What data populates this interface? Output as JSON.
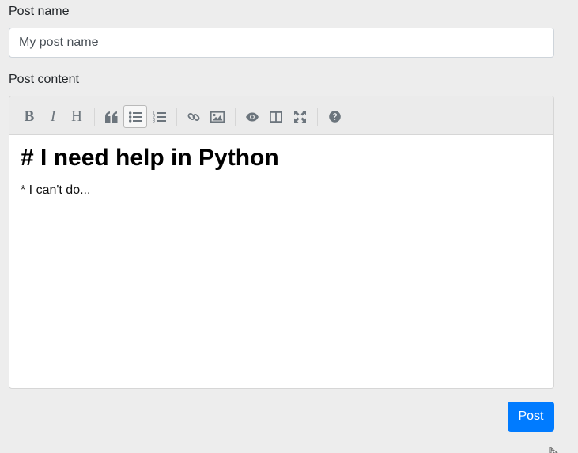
{
  "form": {
    "post_name_label": "Post name",
    "post_name_value": "My post name",
    "post_content_label": "Post content",
    "submit_label": "Post"
  },
  "toolbar": {
    "bold_glyph": "B",
    "italic_glyph": "I",
    "heading_glyph": "H",
    "tools": [
      "bold-icon",
      "italic-icon",
      "heading-icon",
      "quote-icon",
      "unordered-list-icon",
      "ordered-list-icon",
      "link-icon",
      "image-icon",
      "preview-icon",
      "side-by-side-icon",
      "fullscreen-icon",
      "help-icon"
    ],
    "active_tool": "unordered-list-icon"
  },
  "editor": {
    "heading_line": "# I need help in Python",
    "body_line": "* I can't do..."
  },
  "colors": {
    "background": "#ededed",
    "toolbar": "#ebebeb",
    "icon": "#6c757d",
    "primary": "#007bff"
  }
}
